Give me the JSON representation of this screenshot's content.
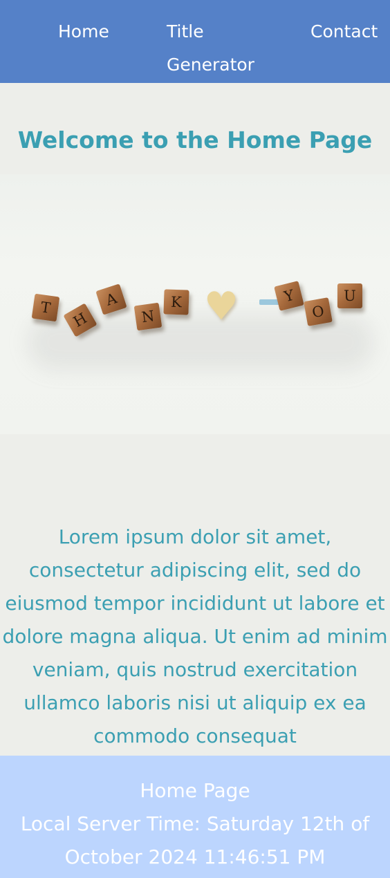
{
  "nav": {
    "home": "Home",
    "title_line1": "Title",
    "title_line2": "Generator",
    "contact": "Contact"
  },
  "main": {
    "heading": "Welcome to the Home Page",
    "paragraph": "Lorem ipsum dolor sit amet, consectetur adipiscing elit, sed do eiusmod tempor incididunt ut labore et dolore magna aliqua. Ut enim ad minim veniam, quis nostrud exercitation ullamco laboris nisi ut aliquip ex ea commodo consequat"
  },
  "footer": {
    "title": "Home Page",
    "server_time": "Local Server Time: Saturday 12th of October 2024 11:46:51 PM"
  },
  "colors": {
    "nav_bg": "#5581c8",
    "accent_text": "#3b9fb2",
    "page_bg": "#edeeea",
    "footer_bg": "#bcd5fe"
  }
}
